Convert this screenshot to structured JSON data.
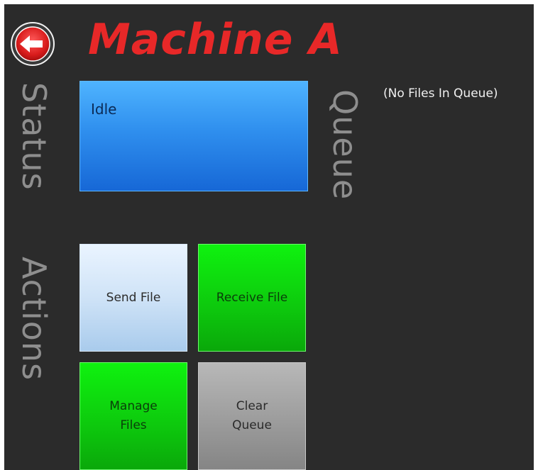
{
  "header": {
    "title": "Machine A",
    "back_icon": "back-arrow-icon",
    "accent_color": "#e82828"
  },
  "sections": {
    "status_label": "Status",
    "actions_label": "Actions",
    "queue_label": "Queue"
  },
  "status": {
    "text": "Idle",
    "panel_color": "#2f8fee"
  },
  "queue": {
    "empty_message": "(No Files In Queue)"
  },
  "actions": {
    "send_file": "Send File",
    "receive_file": "Receive File",
    "manage_files": "Manage\nFiles",
    "clear_queue": "Clear\nQueue"
  }
}
